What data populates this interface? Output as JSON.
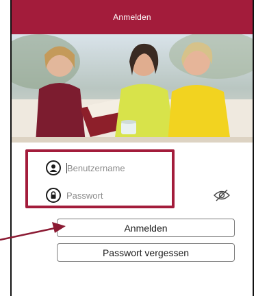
{
  "header": {
    "title": "Anmelden",
    "color": "#a31c3b"
  },
  "hero": {
    "image": "group-photo"
  },
  "form": {
    "username": {
      "placeholder": "Benutzername",
      "icon": "user-circle-icon"
    },
    "password": {
      "placeholder": "Passwort",
      "icon": "lock-icon",
      "toggle_icon": "eye-slash-icon"
    }
  },
  "buttons": {
    "login_label": "Anmelden",
    "forgot_label": "Passwort vergessen"
  },
  "annotation": {
    "highlight_color": "#a31c3b",
    "arrow_color": "#8b1a33"
  }
}
